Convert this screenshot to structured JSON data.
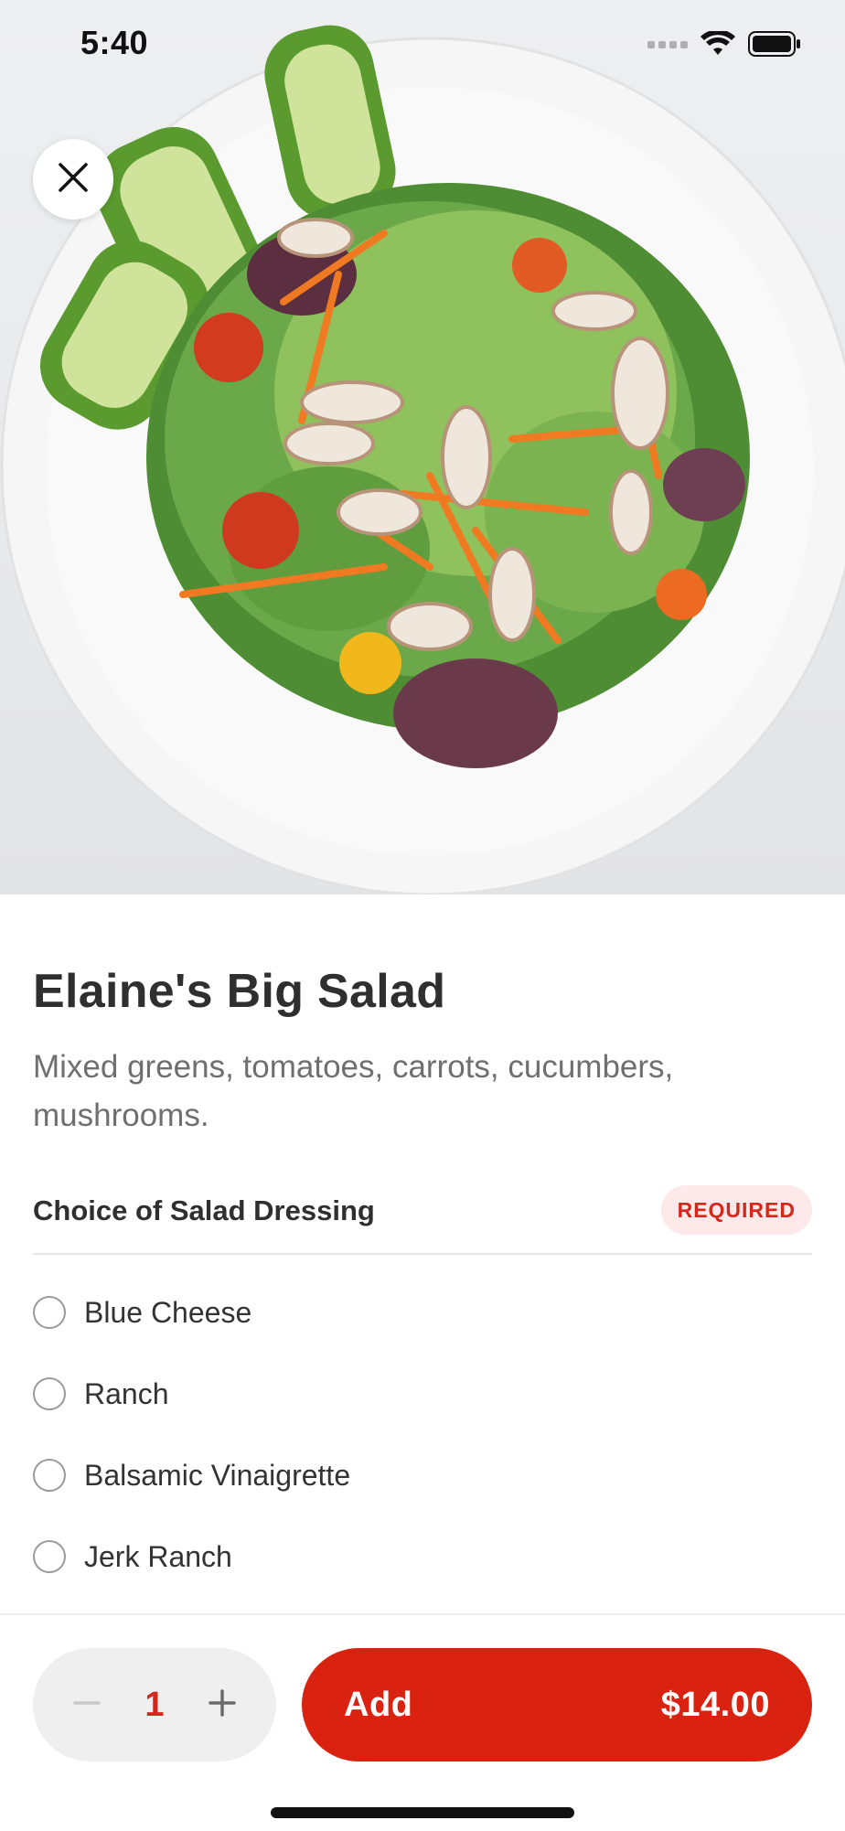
{
  "status_bar": {
    "time": "5:40"
  },
  "item": {
    "title": "Elaine's Big Salad",
    "description": "Mixed greens, tomatoes, carrots, cucumbers, mushrooms."
  },
  "modifier_group": {
    "title": "Choice of Salad Dressing",
    "badge": "REQUIRED",
    "options": [
      {
        "label": "Blue Cheese",
        "selected": false
      },
      {
        "label": "Ranch",
        "selected": false
      },
      {
        "label": "Balsamic Vinaigrette",
        "selected": false
      },
      {
        "label": "Jerk Ranch",
        "selected": false
      }
    ]
  },
  "footer": {
    "quantity": "1",
    "add_label": "Add",
    "price": "$14.00"
  },
  "colors": {
    "accent": "#d92310",
    "badge_bg": "#fde9e9",
    "badge_text": "#d7261b"
  },
  "icons": {
    "close": "close-icon",
    "minus": "minus-icon",
    "plus": "plus-icon",
    "signal": "cellular-signal-icon",
    "wifi": "wifi-icon",
    "battery": "battery-icon"
  }
}
